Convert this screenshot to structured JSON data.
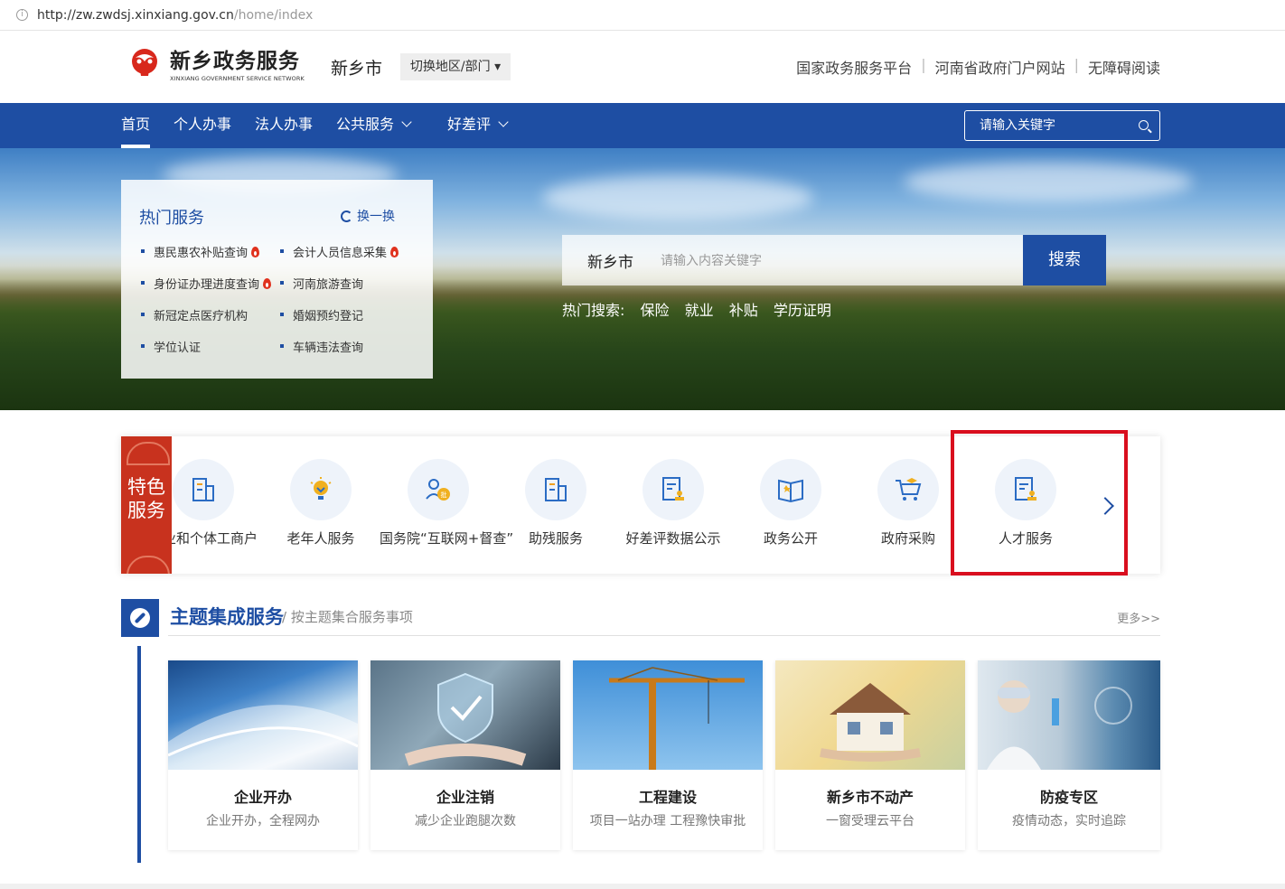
{
  "browser": {
    "url_host": "http://zw.zwdsj.xinxiang.gov.cn",
    "url_path": "/home/index"
  },
  "header": {
    "logo_cn": "新乡政务服务",
    "logo_en": "XINXIANG GOVERNMENT SERVICE NETWORK",
    "city": "新乡市",
    "switch_label": "切换地区/部门",
    "links": [
      "国家政务服务平台",
      "河南省政府门户网站",
      "无障碍阅读"
    ]
  },
  "nav": {
    "items": [
      "首页",
      "个人办事",
      "法人办事",
      "公共服务",
      "好差评"
    ],
    "search_placeholder": "请输入关键字"
  },
  "hot_services": {
    "title": "热门服务",
    "refresh_label": "换一换",
    "items": [
      "惠民惠农补贴查询",
      "会计人员信息采集",
      "身份证办理进度查询",
      "河南旅游查询",
      "新冠定点医疗机构",
      "婚姻预约登记",
      "学位认证",
      "车辆违法查询"
    ]
  },
  "main_search": {
    "location": "新乡市",
    "placeholder": "请输入内容关键字",
    "button": "搜索",
    "hot_label": "热门搜索:",
    "hot_terms": [
      "保险",
      "就业",
      "补贴",
      "学历证明"
    ]
  },
  "special_services": {
    "tag_line1": "特色",
    "tag_line2": "服务",
    "items": [
      "企业和个体工商户",
      "老年人服务",
      "国务院“互联网+督查”",
      "助残服务",
      "好差评数据公示",
      "政务公开",
      "政府采购",
      "人才服务"
    ]
  },
  "theme": {
    "title": "主题集成服务",
    "subtitle": "/ 按主题集合服务事项",
    "more": "更多>>",
    "cards": [
      {
        "name": "企业开办",
        "desc": "企业开办，全程网办"
      },
      {
        "name": "企业注销",
        "desc": "减少企业跑腿次数"
      },
      {
        "name": "工程建设",
        "desc": "项目一站办理 工程豫快审批"
      },
      {
        "name": "新乡市不动产",
        "desc": "一窗受理云平台"
      },
      {
        "name": "防疫专区",
        "desc": "疫情动态，实时追踪"
      }
    ]
  },
  "colors": {
    "primary": "#1e4ea3",
    "accent_red": "#c8321e",
    "highlight_box": "#d90e1e"
  }
}
